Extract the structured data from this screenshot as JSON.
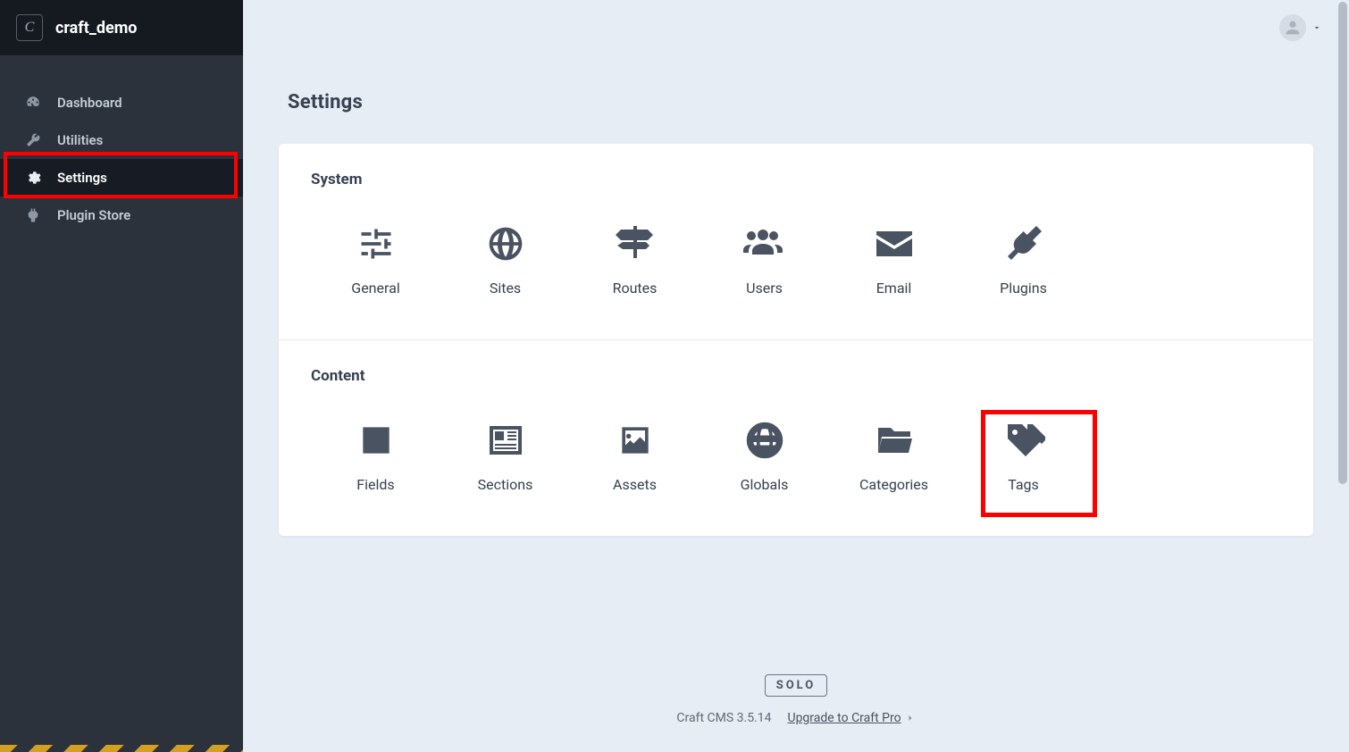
{
  "site": {
    "name": "craft_demo",
    "logo_letter": "C"
  },
  "nav": {
    "items": [
      {
        "label": "Dashboard",
        "icon": "dashboard",
        "selected": false
      },
      {
        "label": "Utilities",
        "icon": "wrench",
        "selected": false
      },
      {
        "label": "Settings",
        "icon": "gear",
        "selected": true
      },
      {
        "label": "Plugin Store",
        "icon": "plug",
        "selected": false
      }
    ]
  },
  "page": {
    "title": "Settings"
  },
  "sections": [
    {
      "title": "System",
      "items": [
        {
          "label": "General",
          "icon": "sliders"
        },
        {
          "label": "Sites",
          "icon": "globe"
        },
        {
          "label": "Routes",
          "icon": "signpost"
        },
        {
          "label": "Users",
          "icon": "users"
        },
        {
          "label": "Email",
          "icon": "envelope"
        },
        {
          "label": "Plugins",
          "icon": "plug-big"
        }
      ]
    },
    {
      "title": "Content",
      "items": [
        {
          "label": "Fields",
          "icon": "pencil-square"
        },
        {
          "label": "Sections",
          "icon": "newspaper"
        },
        {
          "label": "Assets",
          "icon": "image"
        },
        {
          "label": "Globals",
          "icon": "sphere"
        },
        {
          "label": "Categories",
          "icon": "folder"
        },
        {
          "label": "Tags",
          "icon": "tags"
        }
      ]
    }
  ],
  "footer": {
    "badge": "SOLO",
    "version": "Craft CMS 3.5.14",
    "upgrade_link": "Upgrade to Craft Pro"
  },
  "highlights": {
    "sidebar_item_index": 2,
    "content_tile_index": 1
  }
}
